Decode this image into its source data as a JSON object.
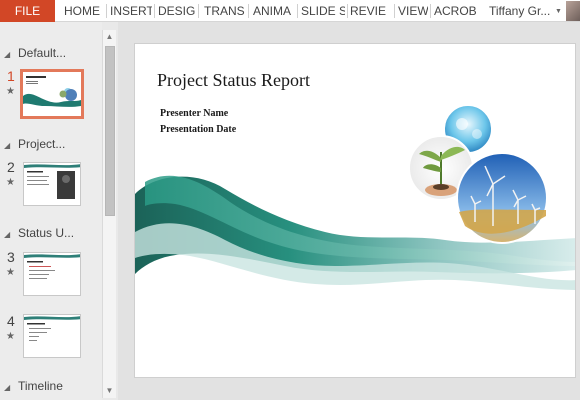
{
  "ribbon": {
    "file_tab": "FILE",
    "tabs": [
      "HOME",
      "INSERT",
      "DESIG",
      "TRANS",
      "ANIMA",
      "SLIDE S",
      "REVIE",
      "VIEW",
      "ACROB"
    ],
    "user_name": "Tiffany Gr...",
    "accent_color": "#d24726"
  },
  "thumbnails": {
    "sections": [
      {
        "label": "Default..."
      },
      {
        "label": "Project..."
      },
      {
        "label": "Status U..."
      },
      {
        "label": "Timeline"
      }
    ],
    "slides": [
      {
        "number": "1",
        "selected": true
      },
      {
        "number": "2",
        "selected": false
      },
      {
        "number": "3",
        "selected": false
      },
      {
        "number": "4",
        "selected": false
      }
    ]
  },
  "slide": {
    "title": "Project Status Report",
    "presenter": "Presenter Name",
    "date": "Presentation Date"
  }
}
